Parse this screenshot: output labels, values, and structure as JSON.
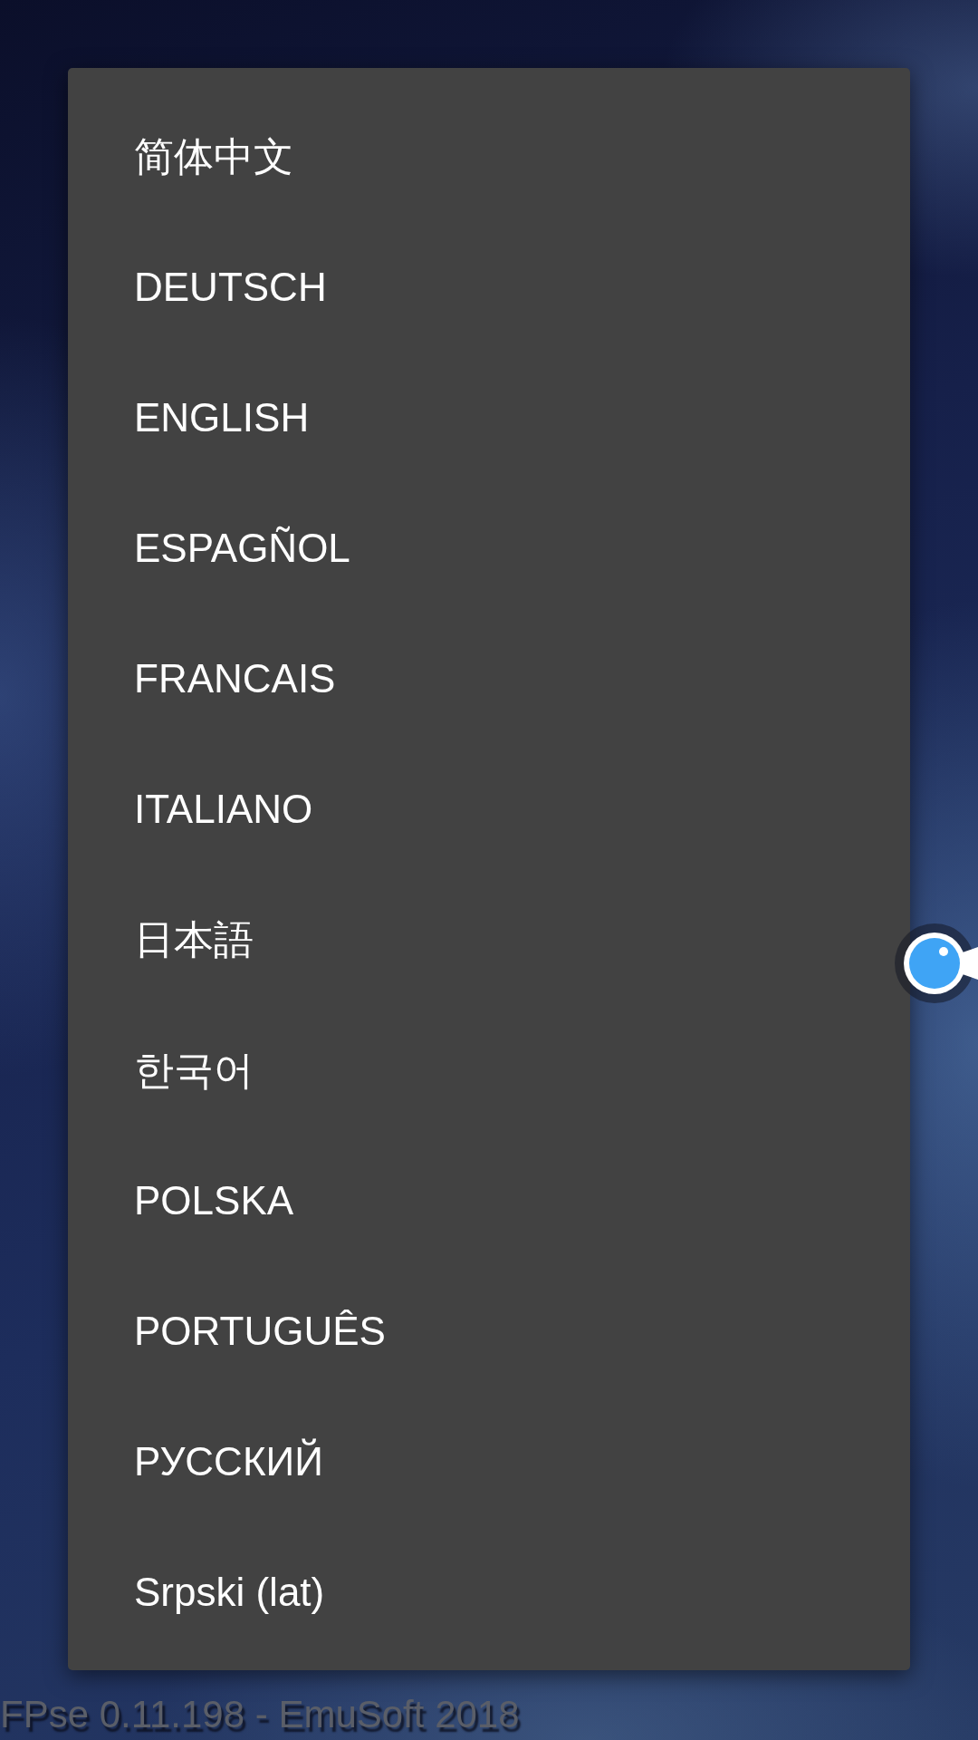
{
  "language_dialog": {
    "items": [
      "简体中文",
      "DEUTSCH",
      "ENGLISH",
      "ESPAGÑOL",
      "FRANCAIS",
      "ITALIANO",
      "日本語",
      "한국어",
      "POLSKA",
      "PORTUGUÊS",
      "РУССКИЙ",
      "Srpski (lat)"
    ]
  },
  "footer": {
    "version_text": "FPse 0.11.198 - EmuSoft 2018"
  }
}
